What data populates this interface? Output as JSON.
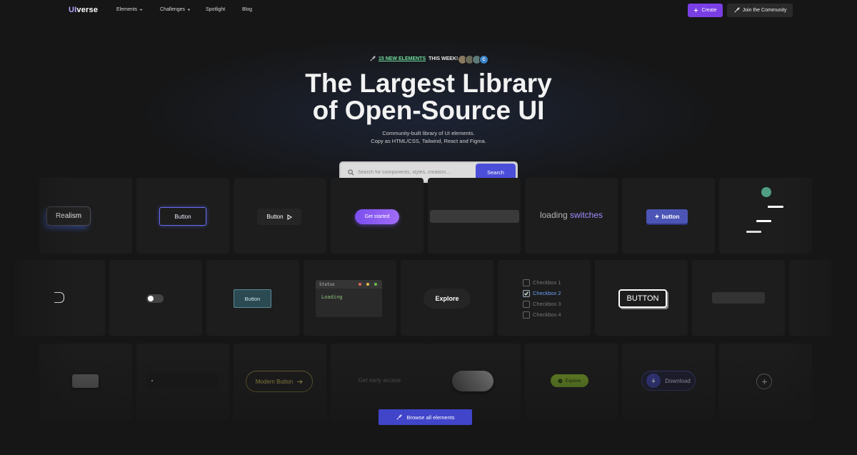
{
  "nav": {
    "logo_prefix": "UI",
    "logo_suffix": "verse",
    "items": [
      {
        "label": "Elements",
        "has_dropdown": true
      },
      {
        "label": "Challenges",
        "has_dropdown": true
      },
      {
        "label": "Spotlight",
        "has_dropdown": false
      },
      {
        "label": "Blog",
        "has_dropdown": false
      }
    ],
    "create_label": "Create",
    "join_label": "Join the Community"
  },
  "hero": {
    "announce_highlight": "15 NEW ELEMENTS",
    "announce_rest": "THIS WEEK!",
    "avatar_letter": "C",
    "title_line1": "The Largest Library",
    "title_line2": "of Open-Source UI",
    "subtitle_line1": "Community-built library of UI elements.",
    "subtitle_line2": "Copy as HTML/CSS, Tailwind, React and Figma."
  },
  "search": {
    "placeholder": "Search for components, styles, creators...",
    "button_label": "Search"
  },
  "gallery": {
    "row1": {
      "realism": "Realism",
      "outline_button": "Button",
      "play_button": "Button",
      "get_started": "Get started",
      "loading_word": "loading",
      "switches_word": "switches",
      "bolt_button": "button"
    },
    "row2": {
      "teal_button": "Button",
      "terminal_title": "Status",
      "terminal_text": "Loading",
      "explore": "Explore",
      "checkboxes": [
        "Checkbox 1",
        "Checkbox 2",
        "Checkbox 3",
        "Checkbox 4"
      ],
      "big_button": "BUTTON"
    },
    "row3": {
      "modern_button": "Modern Button",
      "early_access": "Get early access",
      "lime_button": "Explore",
      "download": "Download"
    }
  },
  "browse_label": "Browse all elements",
  "colors": {
    "background": "#161616",
    "accent_purple": "#7a3fe4",
    "search_blue": "#4a4ed8",
    "highlight_green": "#72e0a0"
  }
}
